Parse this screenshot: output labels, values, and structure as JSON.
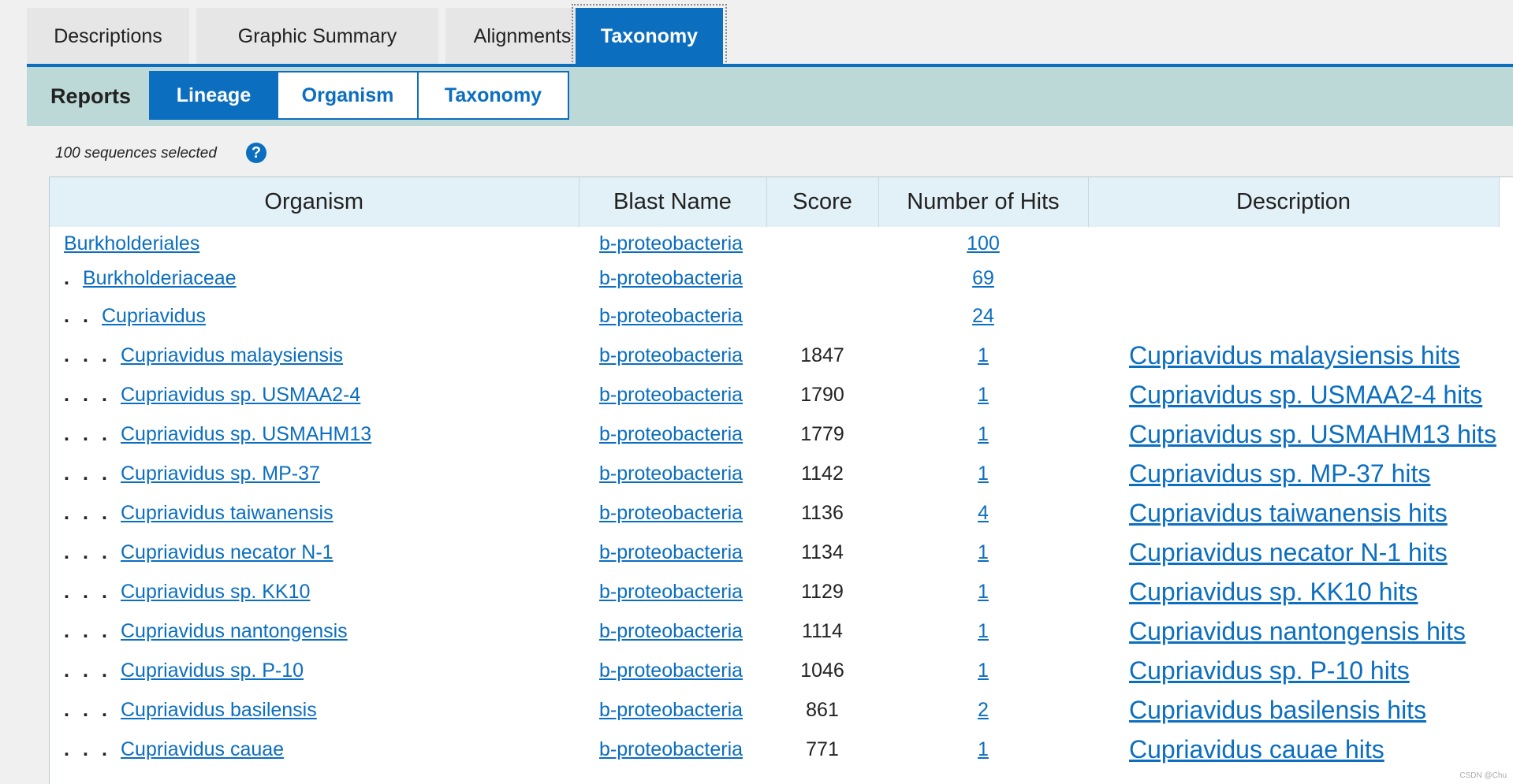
{
  "tabs": [
    {
      "label": "Descriptions",
      "active": false
    },
    {
      "label": "Graphic Summary",
      "active": false
    },
    {
      "label": "Alignments",
      "active": false
    },
    {
      "label": "Taxonomy",
      "active": true
    }
  ],
  "reports": {
    "label": "Reports",
    "buttons": [
      {
        "label": "Lineage",
        "active": true
      },
      {
        "label": "Organism",
        "active": false
      },
      {
        "label": "Taxonomy",
        "active": false
      }
    ]
  },
  "selection": {
    "text": "100 sequences selected",
    "help_icon": "question-circle-icon"
  },
  "table": {
    "headers": [
      "Organism",
      "Blast Name",
      "Score",
      "Number of Hits",
      "Description"
    ],
    "rows": [
      {
        "depth": 0,
        "organism": "Burkholderiales",
        "blast_name": "b-proteobacteria",
        "score": "",
        "hits": "100",
        "description": ""
      },
      {
        "depth": 1,
        "organism": "Burkholderiaceae",
        "blast_name": "b-proteobacteria",
        "score": "",
        "hits": "69",
        "description": ""
      },
      {
        "depth": 2,
        "organism": "Cupriavidus",
        "blast_name": "b-proteobacteria",
        "score": "",
        "hits": "24",
        "description": ""
      },
      {
        "depth": 3,
        "organism": "Cupriavidus malaysiensis",
        "blast_name": "b-proteobacteria",
        "score": "1847",
        "hits": "1",
        "description": "Cupriavidus malaysiensis hits"
      },
      {
        "depth": 3,
        "organism": "Cupriavidus sp. USMAA2-4",
        "blast_name": "b-proteobacteria",
        "score": "1790",
        "hits": "1",
        "description": "Cupriavidus sp. USMAA2-4 hits"
      },
      {
        "depth": 3,
        "organism": "Cupriavidus sp. USMAHM13",
        "blast_name": "b-proteobacteria",
        "score": "1779",
        "hits": "1",
        "description": "Cupriavidus sp. USMAHM13 hits"
      },
      {
        "depth": 3,
        "organism": "Cupriavidus sp. MP-37",
        "blast_name": "b-proteobacteria",
        "score": "1142",
        "hits": "1",
        "description": "Cupriavidus sp. MP-37 hits"
      },
      {
        "depth": 3,
        "organism": "Cupriavidus taiwanensis",
        "blast_name": "b-proteobacteria",
        "score": "1136",
        "hits": "4",
        "description": "Cupriavidus taiwanensis hits"
      },
      {
        "depth": 3,
        "organism": "Cupriavidus necator N-1",
        "blast_name": "b-proteobacteria",
        "score": "1134",
        "hits": "1",
        "description": "Cupriavidus necator N-1 hits"
      },
      {
        "depth": 3,
        "organism": "Cupriavidus sp. KK10",
        "blast_name": "b-proteobacteria",
        "score": "1129",
        "hits": "1",
        "description": "Cupriavidus sp. KK10 hits"
      },
      {
        "depth": 3,
        "organism": "Cupriavidus nantongensis",
        "blast_name": "b-proteobacteria",
        "score": "1114",
        "hits": "1",
        "description": "Cupriavidus nantongensis hits"
      },
      {
        "depth": 3,
        "organism": "Cupriavidus sp. P-10",
        "blast_name": "b-proteobacteria",
        "score": "1046",
        "hits": "1",
        "description": "Cupriavidus sp. P-10 hits"
      },
      {
        "depth": 3,
        "organism": "Cupriavidus basilensis",
        "blast_name": "b-proteobacteria",
        "score": "861",
        "hits": "2",
        "description": "Cupriavidus basilensis hits"
      },
      {
        "depth": 3,
        "organism": "Cupriavidus cauae",
        "blast_name": "b-proteobacteria",
        "score": "771",
        "hits": "1",
        "description": "Cupriavidus cauae hits"
      }
    ]
  },
  "watermark": "CSDN @Chu",
  "colors": {
    "accent": "#0b6ebf",
    "reports_bar": "#bdd9d7",
    "header_bg": "#e2f1f7"
  }
}
